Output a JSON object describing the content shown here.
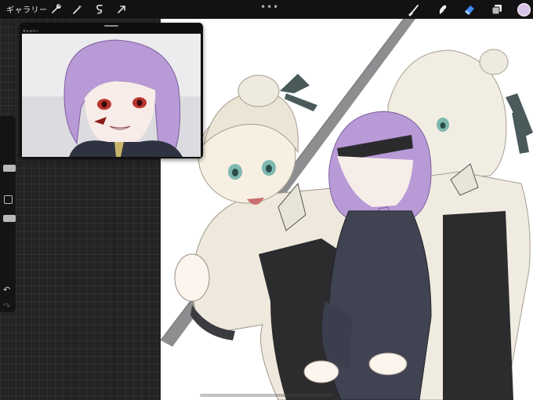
{
  "topbar": {
    "gallery_label": "ギャラリー",
    "left_tools": [
      "wrench-icon",
      "magic-wand-icon",
      "selection-icon",
      "transform-arrow-icon"
    ],
    "right_tools": [
      "brush-icon",
      "smudge-icon",
      "eraser-icon",
      "layers-icon"
    ],
    "current_color": "#d9c2e8"
  },
  "reference": {
    "mini_gallery_label": "ギャラリー"
  },
  "sidebar": {
    "tools": [
      "brush-size-slider",
      "modify-button",
      "opacity-slider",
      "undo-arrow-icon",
      "redo-arrow-icon"
    ]
  },
  "colors": {
    "canvas_bg": "#ffffff",
    "workspace_bg": "#232325",
    "topbar_bg": "#121214",
    "hair_lavender": "#b89ad6",
    "hair_cream": "#eeeadf",
    "outfit_dark": "#2d2d2f",
    "outfit_navy": "#3f4352",
    "ribbon_slate": "#4a5a5a"
  }
}
